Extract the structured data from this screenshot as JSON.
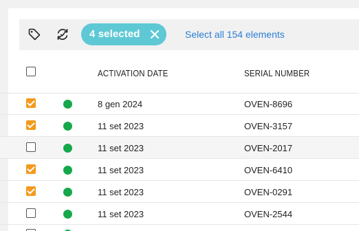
{
  "toolbar": {
    "tag_icon": "tag-icon",
    "refresh_icon": "refresh-icon",
    "selection_chip": "4 selected",
    "select_all": "Select all 154 elements"
  },
  "table": {
    "columns": {
      "activation_date": "ACTIVATION DATE",
      "serial_number": "SERIAL NUMBER"
    },
    "rows": [
      {
        "checked": true,
        "status": "active",
        "activation_date": "8 gen 2024",
        "serial_number": "OVEN-8696"
      },
      {
        "checked": true,
        "status": "active",
        "activation_date": "11 set 2023",
        "serial_number": "OVEN-3157"
      },
      {
        "checked": false,
        "status": "active",
        "activation_date": "11 set 2023",
        "serial_number": "OVEN-2017"
      },
      {
        "checked": true,
        "status": "active",
        "activation_date": "11 set 2023",
        "serial_number": "OVEN-6410"
      },
      {
        "checked": true,
        "status": "active",
        "activation_date": "11 set 2023",
        "serial_number": "OVEN-0291"
      },
      {
        "checked": false,
        "status": "active",
        "activation_date": "11 set 2023",
        "serial_number": "OVEN-2544"
      },
      {
        "checked": false,
        "status": "active",
        "activation_date": "",
        "serial_number": ""
      }
    ]
  },
  "colors": {
    "chip": "#5ec9d5",
    "checkbox_checked": "#f39a1d",
    "status_active": "#15a84a",
    "link": "#2a7fd4"
  }
}
